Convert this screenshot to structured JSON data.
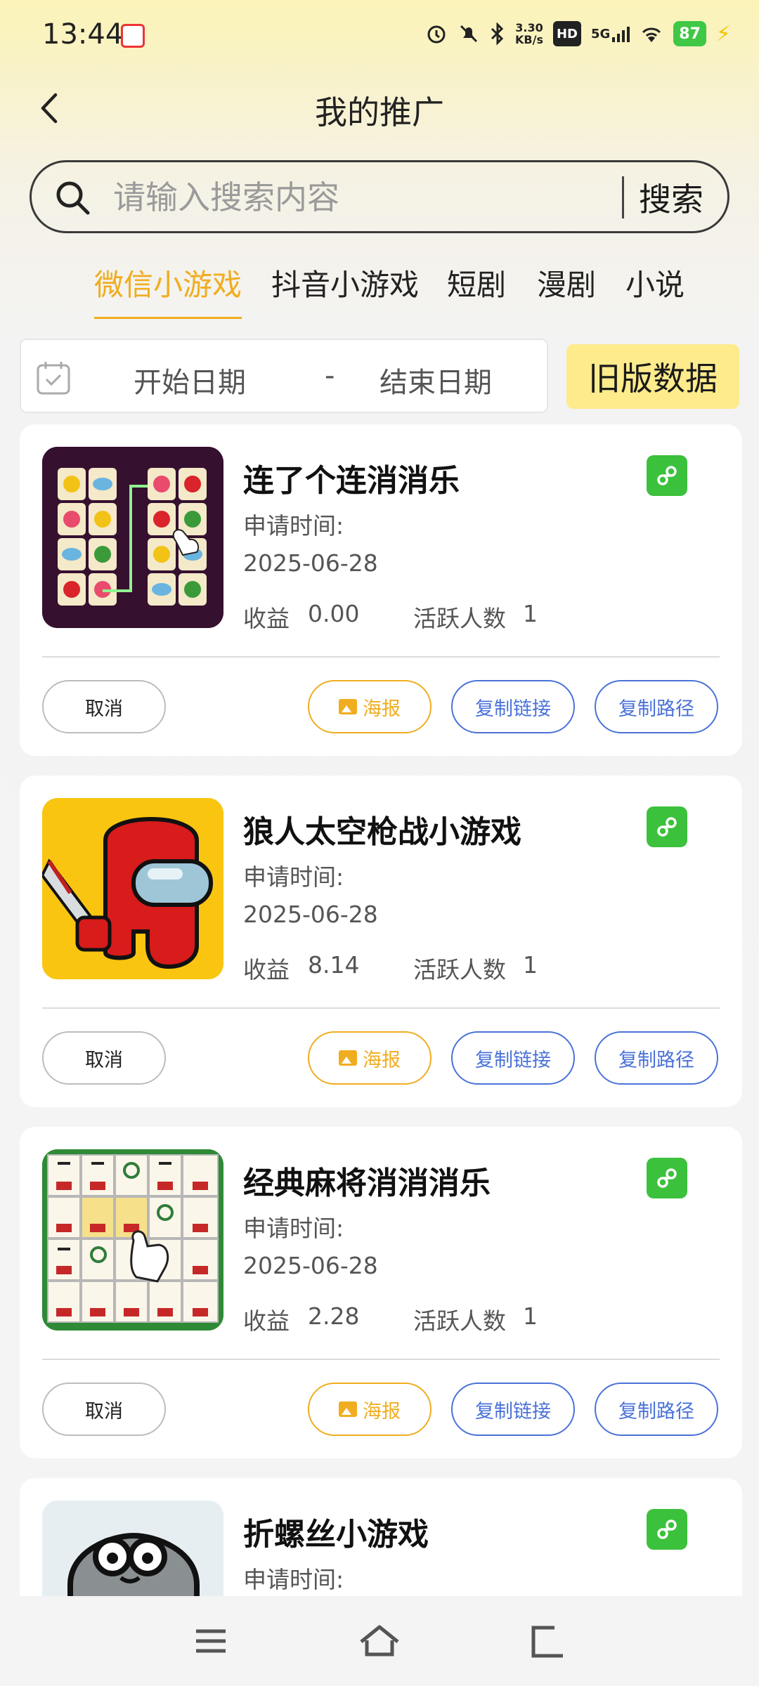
{
  "status_bar": {
    "time": "13:44",
    "net_speed_value": "3.30",
    "net_speed_unit": "KB/s",
    "hd": "HD",
    "signal": "5G",
    "battery": "87"
  },
  "header": {
    "title": "我的推广"
  },
  "search": {
    "placeholder": "请输入搜索内容",
    "button_label": "搜索"
  },
  "tabs": [
    {
      "label": "微信小游戏",
      "active": true
    },
    {
      "label": "抖音小游戏",
      "active": false
    },
    {
      "label": "短剧",
      "active": false
    },
    {
      "label": "漫剧",
      "active": false
    },
    {
      "label": "小说",
      "active": false
    }
  ],
  "date_filter": {
    "start_placeholder": "开始日期",
    "separator": "-",
    "end_placeholder": "结束日期",
    "old_data_button": "旧版数据"
  },
  "labels": {
    "apply_time": "申请时间:",
    "earnings": "收益",
    "active_users": "活跃人数",
    "cancel": "取消",
    "poster": "海报",
    "copy_link": "复制链接",
    "copy_path": "复制路径"
  },
  "games": [
    {
      "title": "连了个连消消乐",
      "apply_date": "2025-06-28",
      "earnings": "0.00",
      "active": "1",
      "thumb": "onet-animal-tiles"
    },
    {
      "title": "狼人太空枪战小游戏",
      "apply_date": "2025-06-28",
      "earnings": "8.14",
      "active": "1",
      "thumb": "red-crewmate-knife"
    },
    {
      "title": "经典麻将消消消乐",
      "apply_date": "2025-06-28",
      "earnings": "2.28",
      "active": "1",
      "thumb": "mahjong-tiles"
    },
    {
      "title": "折螺丝小游戏",
      "thumb": "grey-frog-character"
    }
  ],
  "colors": {
    "accent": "#f0ad1f",
    "link_blue": "#4a72d8",
    "mini_program_green": "#3cc13c",
    "old_data_bg": "#fdeb8c"
  }
}
